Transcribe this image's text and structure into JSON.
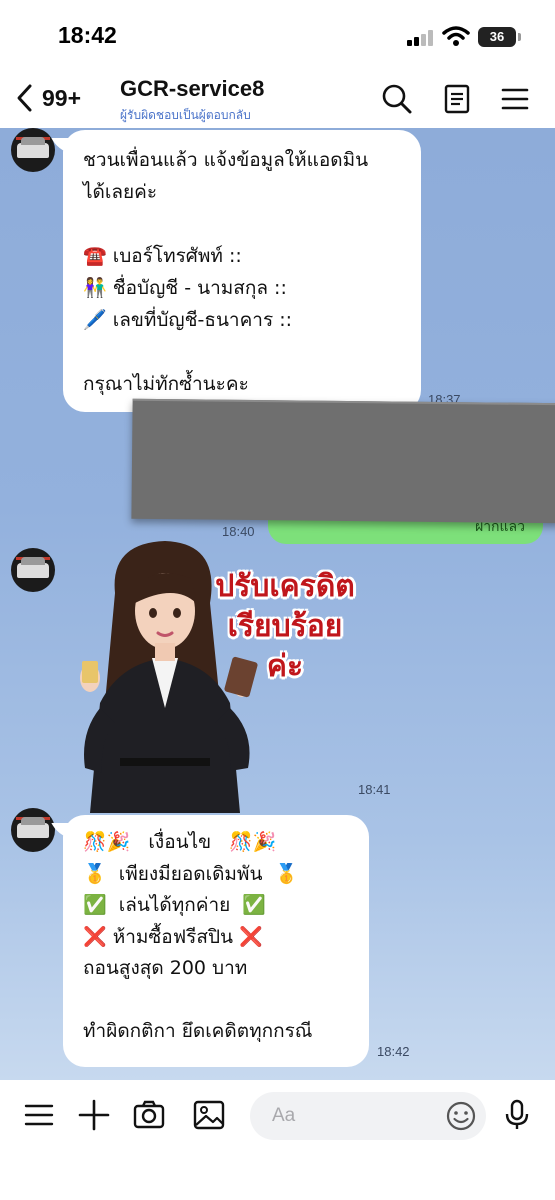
{
  "status": {
    "time": "18:42",
    "battery": "36"
  },
  "header": {
    "unread_count": "99+",
    "title": "GCR-service8",
    "subtitle": "ผู้รับผิดชอบเป็นผู้ตอบกลับ"
  },
  "messages": [
    {
      "text": "ชวนเพื่อนแล้ว แจ้งข้อมูลให้แอดมิน\nได้เลยค่ะ\n\n☎️ เบอร์โทรศัพท์ ::\n👫 ชื่อบัญชี - นามสกุล ::\n🖊️ เลขที่บัญชี-ธนาคาร ::\n\nกรุณาไม่ทักซ้ำนะคะ",
      "time": "18:37"
    },
    {
      "time": "18:40",
      "green_text": "ฝากแล้ว"
    },
    {
      "sticker_text": [
        "ปรับเครดิต",
        "เรียบร้อย",
        "ค่ะ"
      ],
      "time": "18:41"
    },
    {
      "text": "🎊🎉   เงื่อนไข   🎊🎉\n🥇  เพียงมียอดเดิมพัน  🥇\n✅  เล่นได้ทุกค่าย  ✅\n❌ ห้ามซื้อฟรีสปิน ❌\nถอนสูงสุด 200 บาท\n\nทำผิดกติกา ยึดเคดิตทุกกรณี",
      "time": "18:42"
    }
  ],
  "input": {
    "placeholder": "Aa"
  },
  "colors": {
    "chat_bg": "#8faedc",
    "bubble": "#ffffff",
    "sent": "#7de07a",
    "accent_text": "#4a73c9"
  }
}
